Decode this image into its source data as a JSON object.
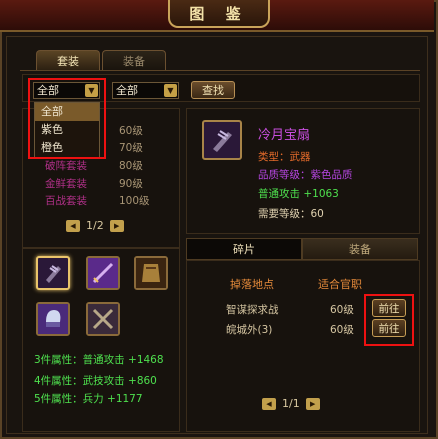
{
  "window": {
    "title": "图 鉴"
  },
  "tabs": [
    {
      "label": "套装"
    },
    {
      "label": "装备"
    }
  ],
  "filters": {
    "type_select": {
      "value": "全部"
    },
    "level_select": {
      "value": "全部"
    },
    "search_label": "查找",
    "dropdown_options": [
      "全部",
      "紫色",
      "橙色"
    ]
  },
  "suit_list": [
    {
      "name": "",
      "level": "60级"
    },
    {
      "name": "",
      "level": "70级"
    },
    {
      "name": "破阵套装",
      "level": "80级"
    },
    {
      "name": "金鲜套装",
      "level": "90级"
    },
    {
      "name": "百战套装",
      "level": "100级"
    }
  ],
  "suit_pager": {
    "text": "1/2"
  },
  "item_icons": [
    {
      "icon": "claw-weapon-icon"
    },
    {
      "icon": "sword-icon"
    },
    {
      "icon": "armor-icon"
    },
    {
      "icon": "helmet-icon"
    },
    {
      "icon": "crossed-weapons-icon"
    }
  ],
  "set_bonuses": [
    {
      "text": "3件属性：普通攻击 +1468"
    },
    {
      "text": "4件属性：武技攻击 +860"
    },
    {
      "text": "5件属性：兵力 +1177"
    }
  ],
  "detail": {
    "name": "冷月宝扇",
    "type": "类型：武器",
    "quality": "品质等级：紫色品质",
    "stat": "普通攻击 +1063",
    "level": "需要等级：60"
  },
  "sub_tabs": [
    {
      "label": "碎片"
    },
    {
      "label": "装备"
    }
  ],
  "drop_table": {
    "headers": [
      "掉落地点",
      "适合官职"
    ],
    "rows": [
      {
        "location": "智谋探求战",
        "level": "60级",
        "button": "前往"
      },
      {
        "location": "皖城外(3)",
        "level": "60级",
        "button": "前往"
      }
    ],
    "pager": "1/1"
  },
  "colors": {
    "highlight_box": "#ee1111",
    "set_bonus": "#4ee04e",
    "purple_name": "#c94fe0"
  }
}
